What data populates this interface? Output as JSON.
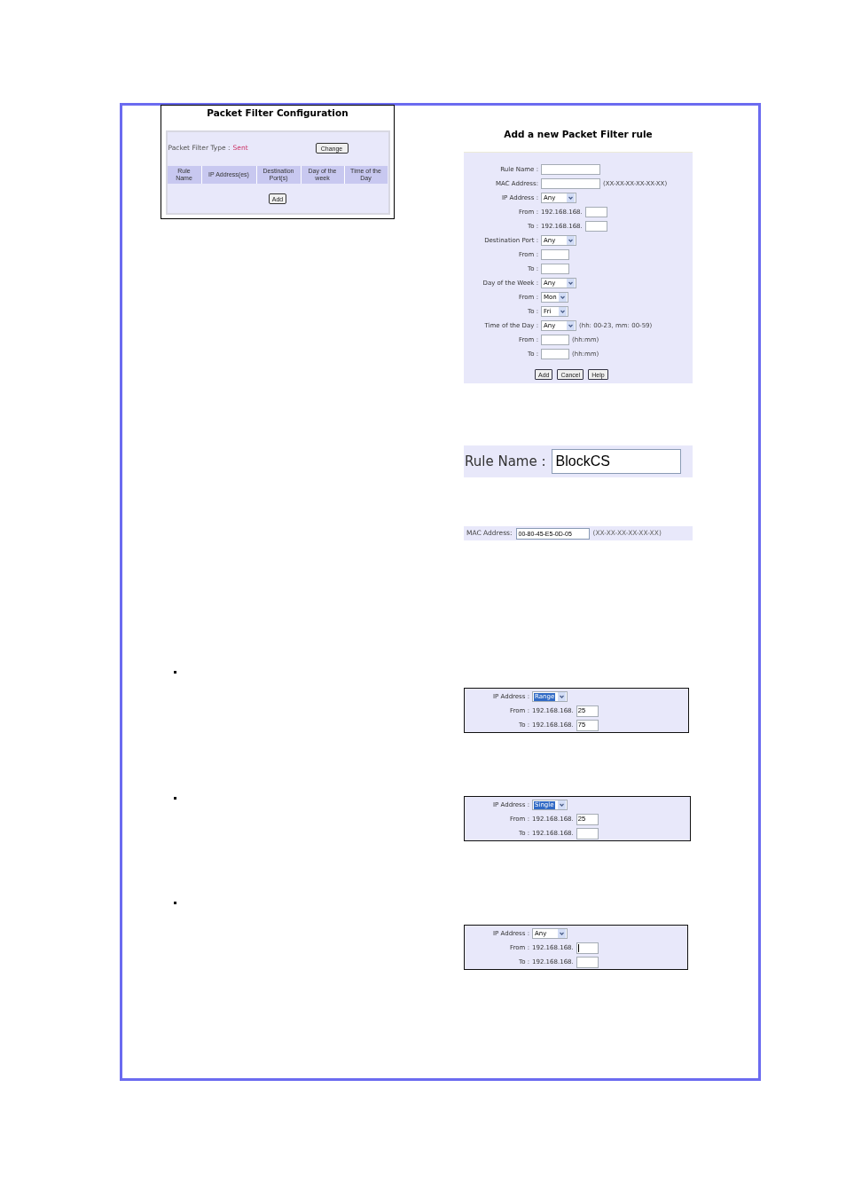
{
  "config_screenshot": {
    "title": "Packet Filter Configuration",
    "filter_type": {
      "label": "Packet Filter Type :",
      "value": "Sent"
    },
    "change_button": "Change",
    "table": {
      "columns": [
        "Rule Name",
        "IP Address(es)",
        "Destination Port(s)",
        "Day of the week",
        "Time of the Day"
      ]
    },
    "add_button": "Add"
  },
  "rule_form": {
    "title": "Add a new Packet Filter rule",
    "rows": [
      {
        "kind": "text",
        "label": "Rule Name :"
      },
      {
        "kind": "text",
        "label": "MAC Address:",
        "hint": "(XX-XX-XX-XX-XX-XX)"
      },
      {
        "kind": "select",
        "label": "IP Address :",
        "value": "Any",
        "highlighted": false
      },
      {
        "kind": "ip",
        "label": "From :",
        "prefix": "192.168.168.",
        "focused": false
      },
      {
        "kind": "ip",
        "label": "To :",
        "prefix": "192.168.168.",
        "focused": false
      },
      {
        "kind": "select",
        "label": "Destination Port :",
        "value": "Any",
        "highlighted": false
      },
      {
        "kind": "short",
        "label": "From :"
      },
      {
        "kind": "short",
        "label": "To :"
      },
      {
        "kind": "select",
        "label": "Day of the Week :",
        "value": "Any",
        "highlighted": false
      },
      {
        "kind": "compact",
        "label": "From :",
        "value": "Mon",
        "highlighted": false
      },
      {
        "kind": "compact",
        "label": "To :",
        "value": "Fri",
        "highlighted": false
      },
      {
        "kind": "select",
        "label": "Time of the Day :",
        "value": "Any",
        "highlighted": false,
        "hint": "(hh: 00-23, mm: 00-59)"
      },
      {
        "kind": "short",
        "label": "From :",
        "hint": "(hh:mm)"
      },
      {
        "kind": "short",
        "label": "To :",
        "hint": "(hh:mm)"
      }
    ],
    "buttons": [
      "Add",
      "Cancel",
      "Help"
    ]
  },
  "rule_name_detail": {
    "label": "Rule Name :",
    "value": "BlockCS"
  },
  "mac_detail": {
    "label": "MAC Address:",
    "value": "00-80-45-E5-0D-05",
    "hint": "(XX-XX-XX-XX-XX-XX)"
  },
  "ip_examples": [
    {
      "rows": [
        {
          "kind": "select",
          "label": "IP Address :",
          "value": "Range",
          "highlighted": true
        },
        {
          "kind": "ip",
          "label": "From :",
          "prefix": "192.168.168.",
          "value": "25",
          "focused": false
        },
        {
          "kind": "ip",
          "label": "To :",
          "prefix": "192.168.168.",
          "value": "75",
          "focused": false
        }
      ]
    },
    {
      "rows": [
        {
          "kind": "select",
          "label": "IP Address :",
          "value": "Single",
          "highlighted": true
        },
        {
          "kind": "ip",
          "label": "From :",
          "prefix": "192.168.168.",
          "value": "25",
          "focused": false
        },
        {
          "kind": "ip",
          "label": "To :",
          "prefix": "192.168.168.",
          "focused": false
        }
      ]
    },
    {
      "rows": [
        {
          "kind": "select",
          "label": "IP Address :",
          "value": "Any",
          "highlighted": false
        },
        {
          "kind": "ip",
          "label": "From :",
          "prefix": "192.168.168.",
          "focused": true
        },
        {
          "kind": "ip",
          "label": "To :",
          "prefix": "192.168.168.",
          "focused": false
        }
      ]
    }
  ]
}
